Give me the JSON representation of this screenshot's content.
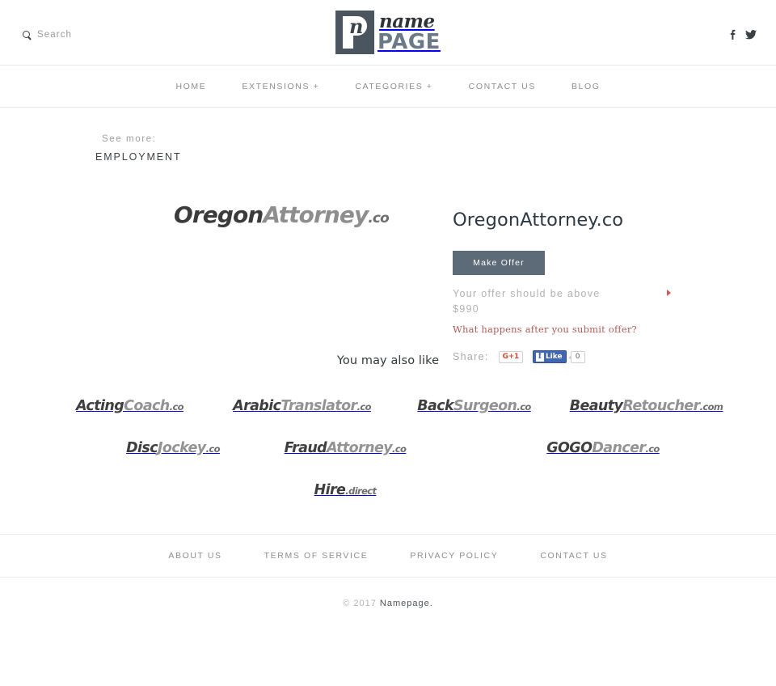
{
  "header": {
    "search": {
      "label": "Search",
      "icon": "search-icon"
    },
    "logo": {
      "mark_glyph": "n",
      "name_text": "name",
      "page_text": "PAGE"
    },
    "social": [
      {
        "name": "facebook-icon",
        "glyph": "f"
      },
      {
        "name": "twitter-icon",
        "glyph": "twitter"
      }
    ]
  },
  "nav": {
    "items": [
      {
        "label": "HOME"
      },
      {
        "label": "EXTENSIONS +"
      },
      {
        "label": "CATEGORIES +"
      },
      {
        "label": "CONTACT US"
      },
      {
        "label": "BLOG"
      }
    ]
  },
  "breadcrumb": {
    "see_more_label": "See more:",
    "category": "EMPLOYMENT"
  },
  "product": {
    "art": {
      "word1": "Oregon",
      "word2": "Attorney",
      "tld": ".co"
    },
    "title": "OregonAttorney.co",
    "make_offer_label": "Make Offer",
    "offer_note": "Your offer should be above $990",
    "offer_minimum": "$990",
    "offer_link": "What happens after you submit offer?",
    "share_label": "Share:",
    "gplus_label": "G+1",
    "fb_like_label": "Like",
    "fb_like_count": "0"
  },
  "also_like": {
    "title": "You may also like",
    "items": [
      {
        "word1": "Acting",
        "word2": "Coach",
        "tld": ".co"
      },
      {
        "word1": "Arabic",
        "word2": "Translator",
        "tld": ".co"
      },
      {
        "word1": "Back",
        "word2": "Surgeon",
        "tld": ".co"
      },
      {
        "word1": "Beauty",
        "word2": "Retoucher",
        "tld": ".com"
      },
      {
        "word1": "Disc",
        "word2": "Jockey",
        "tld": ".co"
      },
      {
        "word1": "Fraud",
        "word2": "Attorney",
        "tld": ".co"
      },
      {
        "word1": "GOGO",
        "word2": "Dancer",
        "tld": ".co"
      },
      {
        "word1": "Hire",
        "word2": "",
        "tld": ".direct"
      }
    ]
  },
  "footer": {
    "links": [
      {
        "label": "ABOUT US"
      },
      {
        "label": "TERMS OF SERVICE"
      },
      {
        "label": "PRIVACY POLICY"
      },
      {
        "label": "CONTACT US"
      }
    ],
    "copyright_prefix": "© 2017",
    "copyright_brand": "Namepage."
  },
  "colors": {
    "accent_button": "#5c6b77",
    "link_red": "#b05a56",
    "arrow_red": "#d9534f",
    "logo_page": "#6c7a88",
    "fb_blue": "#4267b2",
    "gplus_red": "#d34836"
  }
}
